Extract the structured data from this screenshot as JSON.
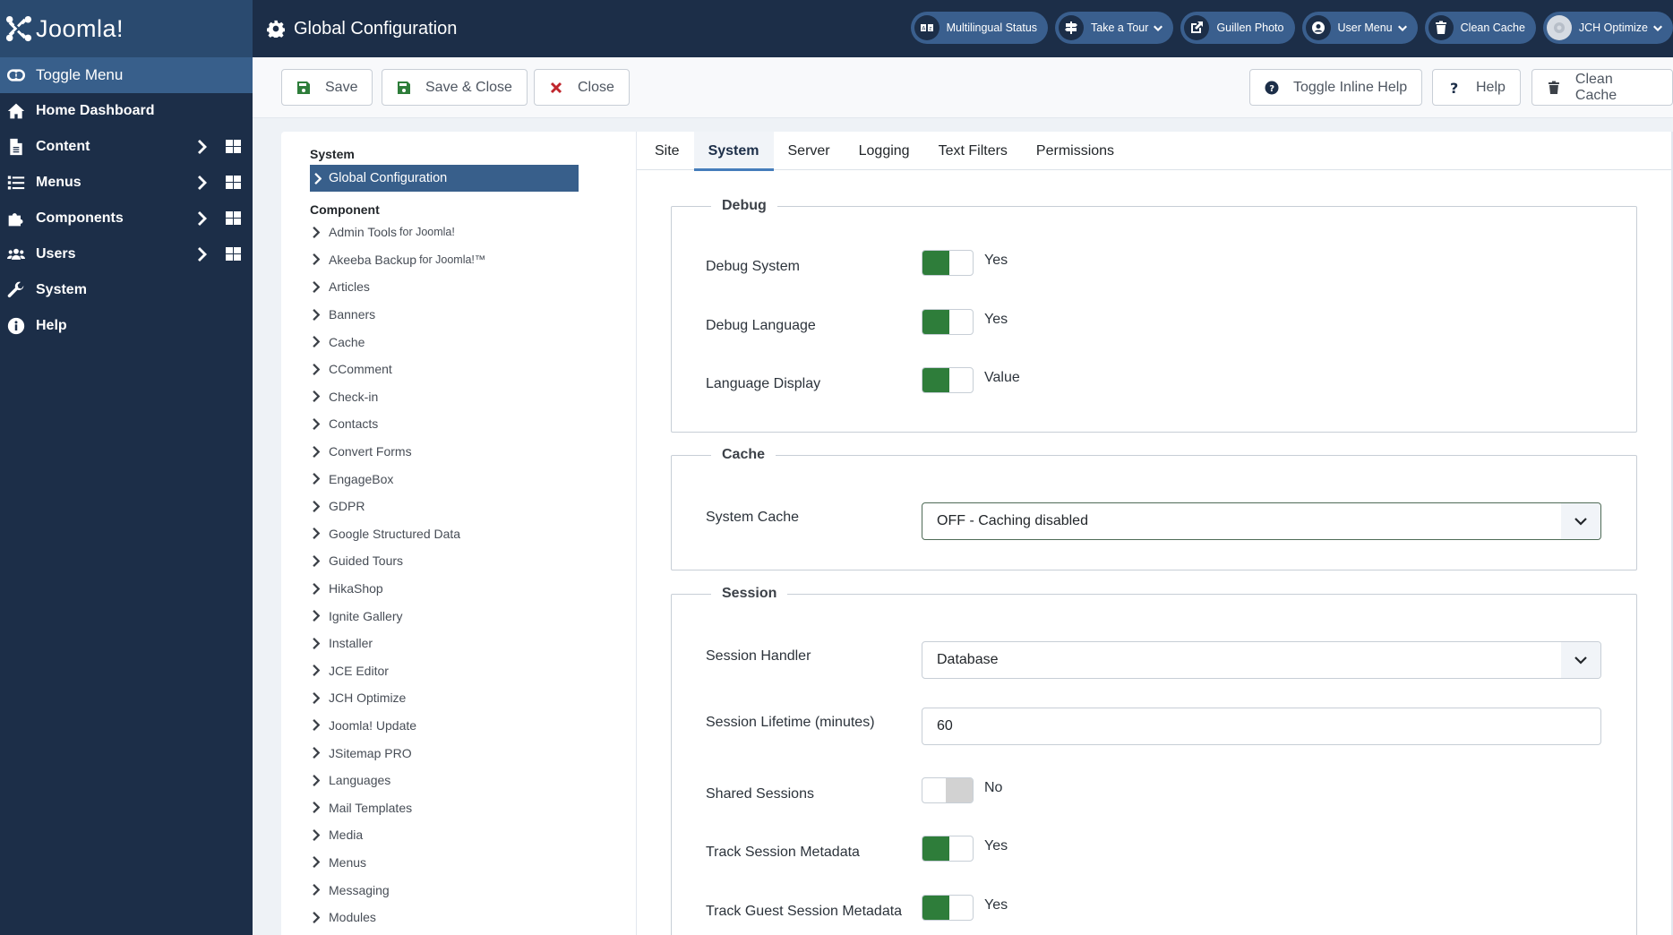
{
  "brand": {
    "name": "Joomla!"
  },
  "sidebar": {
    "toggle_label": "Toggle Menu",
    "items": [
      {
        "label": "Home Dashboard",
        "icon": "home-icon",
        "has_submenu": false
      },
      {
        "label": "Content",
        "icon": "file-icon",
        "has_submenu": true
      },
      {
        "label": "Menus",
        "icon": "list-icon",
        "has_submenu": true
      },
      {
        "label": "Components",
        "icon": "puzzle-icon",
        "has_submenu": true
      },
      {
        "label": "Users",
        "icon": "users-icon",
        "has_submenu": true
      },
      {
        "label": "System",
        "icon": "wrench-icon",
        "has_submenu": false
      },
      {
        "label": "Help",
        "icon": "info-icon",
        "has_submenu": false
      }
    ]
  },
  "header": {
    "title": "Global Configuration",
    "pills": [
      {
        "label": "Multilingual Status",
        "icon": "language-icon",
        "dropdown": false
      },
      {
        "label": "Take a Tour",
        "icon": "signpost-icon",
        "dropdown": true
      },
      {
        "label": "Guillen Photo",
        "icon": "external-link-icon",
        "dropdown": false
      },
      {
        "label": "User Menu",
        "icon": "user-circle-icon",
        "dropdown": true
      },
      {
        "label": "Clean Cache",
        "icon": "trash-icon",
        "dropdown": false
      },
      {
        "label": "JCH Optimize",
        "icon": "jch-optimize-icon",
        "dropdown": true
      }
    ]
  },
  "toolbar": {
    "save": "Save",
    "save_close": "Save & Close",
    "close": "Close",
    "toggle_inline_help": "Toggle Inline Help",
    "help": "Help",
    "clean_cache": "Clean Cache"
  },
  "config_nav": {
    "system_heading": "System",
    "active_item": "Global Configuration",
    "component_heading": "Component",
    "components": [
      {
        "label": "Admin Tools",
        "suffix": "for Joomla!"
      },
      {
        "label": "Akeeba Backup",
        "suffix": "for Joomla!™"
      },
      {
        "label": "Articles"
      },
      {
        "label": "Banners"
      },
      {
        "label": "Cache"
      },
      {
        "label": "CComment"
      },
      {
        "label": "Check-in"
      },
      {
        "label": "Contacts"
      },
      {
        "label": "Convert Forms"
      },
      {
        "label": "EngageBox"
      },
      {
        "label": "GDPR"
      },
      {
        "label": "Google Structured Data"
      },
      {
        "label": "Guided Tours"
      },
      {
        "label": "HikaShop"
      },
      {
        "label": "Ignite Gallery"
      },
      {
        "label": "Installer"
      },
      {
        "label": "JCE Editor"
      },
      {
        "label": "JCH Optimize"
      },
      {
        "label": "Joomla! Update"
      },
      {
        "label": "JSitemap PRO"
      },
      {
        "label": "Languages"
      },
      {
        "label": "Mail Templates"
      },
      {
        "label": "Media"
      },
      {
        "label": "Menus"
      },
      {
        "label": "Messaging"
      },
      {
        "label": "Modules"
      }
    ]
  },
  "tabs": [
    {
      "label": "Site",
      "active": false
    },
    {
      "label": "System",
      "active": true
    },
    {
      "label": "Server",
      "active": false
    },
    {
      "label": "Logging",
      "active": false
    },
    {
      "label": "Text Filters",
      "active": false
    },
    {
      "label": "Permissions",
      "active": false
    }
  ],
  "sections": {
    "debug": {
      "legend": "Debug",
      "fields": [
        {
          "label": "Debug System",
          "type": "switch",
          "on": true,
          "value": "Yes"
        },
        {
          "label": "Debug Language",
          "type": "switch",
          "on": true,
          "value": "Yes"
        },
        {
          "label": "Language Display",
          "type": "switch",
          "on": true,
          "value": "Value"
        }
      ]
    },
    "cache": {
      "legend": "Cache",
      "fields": [
        {
          "label": "System Cache",
          "type": "select",
          "value": "OFF - Caching disabled"
        }
      ]
    },
    "session": {
      "legend": "Session",
      "fields": [
        {
          "label": "Session Handler",
          "type": "select",
          "value": "Database"
        },
        {
          "label": "Session Lifetime (minutes)",
          "type": "input",
          "value": "60"
        },
        {
          "label": "Shared Sessions",
          "type": "switch",
          "on": false,
          "value": "No"
        },
        {
          "label": "Track Session Metadata",
          "type": "switch",
          "on": true,
          "value": "Yes"
        },
        {
          "label": "Track Guest Session Metadata",
          "type": "switch",
          "on": true,
          "value": "Yes"
        }
      ]
    }
  },
  "colors": {
    "sidebar_bg": "#1c2e48",
    "accent": "#385f8b",
    "switch_on": "#2e7d3a",
    "save_icon": "#2e7d3a",
    "close_icon": "#c0262d"
  }
}
